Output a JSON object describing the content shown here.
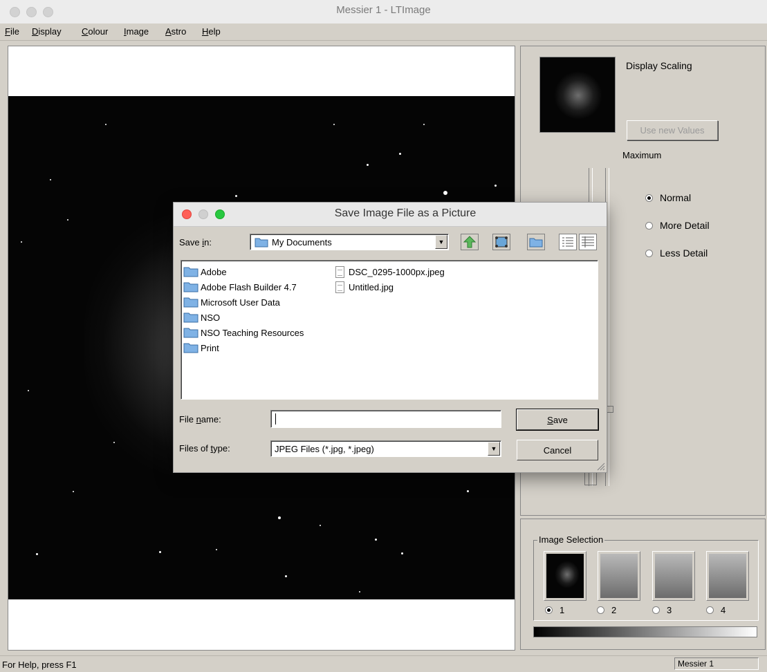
{
  "window": {
    "title": "Messier 1 - LTImage"
  },
  "menu": [
    {
      "pre": "",
      "key": "F",
      "post": "ile"
    },
    {
      "pre": "",
      "key": "D",
      "post": "isplay"
    },
    {
      "pre": "",
      "key": "C",
      "post": "olour"
    },
    {
      "pre": "",
      "key": "I",
      "post": "mage"
    },
    {
      "pre": "",
      "key": "A",
      "post": "stro"
    },
    {
      "pre": "",
      "key": "H",
      "post": "elp"
    }
  ],
  "display_panel": {
    "heading": "Display Scaling",
    "use_new_values": "Use new Values",
    "maximum_label": "Maximum",
    "options": [
      "Normal",
      "More Detail",
      "Less Detail"
    ],
    "selected": "Normal"
  },
  "image_selection": {
    "title": "Image Selection",
    "slots": [
      "1",
      "2",
      "3",
      "4"
    ],
    "selected": "1"
  },
  "status": {
    "help": "For Help, press F1",
    "pane": "Messier 1"
  },
  "dialog": {
    "title": "Save Image File as a Picture",
    "save_in_label": {
      "pre": "Save ",
      "key": "i",
      "post": "n:"
    },
    "save_in_value": "My Documents",
    "folders": [
      "Adobe",
      "Adobe Flash Builder 4.7",
      "Microsoft User Data",
      "NSO",
      "NSO Teaching Resources",
      "Print"
    ],
    "files": [
      "DSC_0295-1000px.jpeg",
      "Untitled.jpg"
    ],
    "file_name_label": {
      "pre": "File ",
      "key": "n",
      "post": "ame:"
    },
    "file_name_value": "",
    "file_type_label": {
      "pre": "Files of ",
      "key": "t",
      "post": "ype:"
    },
    "file_type_value": "JPEG Files (*.jpg, *.jpeg)",
    "save_button": {
      "pre": "",
      "key": "S",
      "post": "ave"
    },
    "cancel_button": "Cancel",
    "colors": {
      "close": "#fe5f57",
      "minimize": "#d0d0d0",
      "zoom": "#28c840"
    }
  }
}
